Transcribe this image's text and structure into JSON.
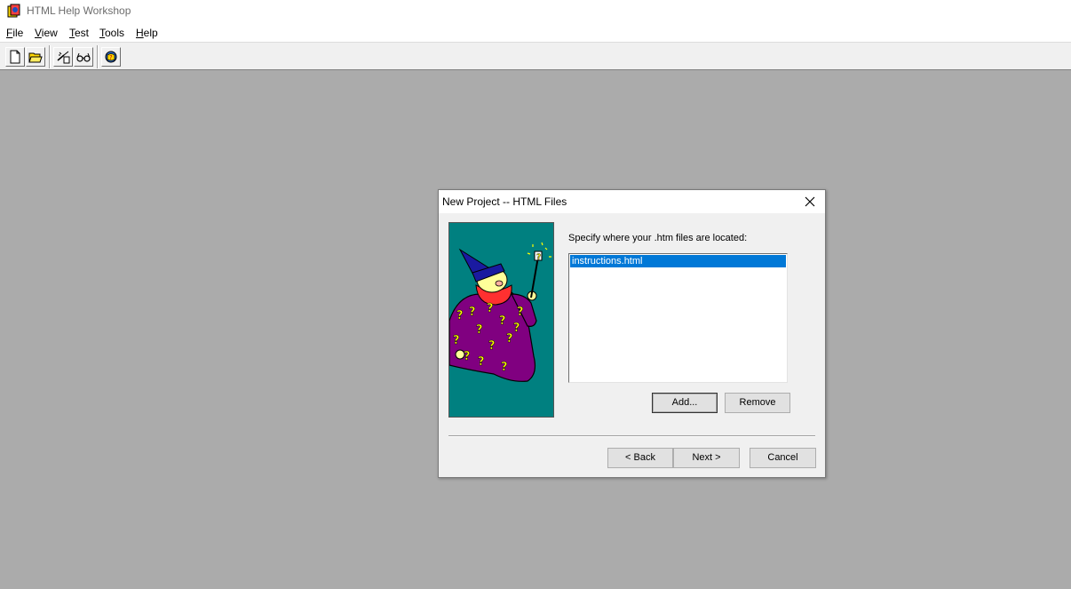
{
  "app": {
    "title": "HTML Help Workshop",
    "icon": "html-help-workshop-icon"
  },
  "menu": [
    {
      "label": "File",
      "accel": "F",
      "rest": "ile"
    },
    {
      "label": "View",
      "accel": "V",
      "rest": "iew"
    },
    {
      "label": "Test",
      "accel": "T",
      "rest": "est"
    },
    {
      "label": "Tools",
      "accel": "T",
      "rest": "ools"
    },
    {
      "label": "Help",
      "accel": "H",
      "rest": "elp"
    }
  ],
  "toolbar": {
    "buttons": [
      "new-icon",
      "open-icon",
      "compile-icon",
      "view-compiled-icon",
      "html-help-api-icon"
    ]
  },
  "dialog": {
    "title": "New Project -- HTML Files",
    "prompt": "Specify where your .htm files are located:",
    "files": [
      "instructions.html"
    ],
    "add_label": "Add...",
    "remove_label": "Remove",
    "back_label": "< Back",
    "next_label": "Next >",
    "cancel_label": "Cancel"
  },
  "colors": {
    "workspace": "#ababab",
    "wizard_bg": "#008080",
    "selection": "#0078d7"
  }
}
